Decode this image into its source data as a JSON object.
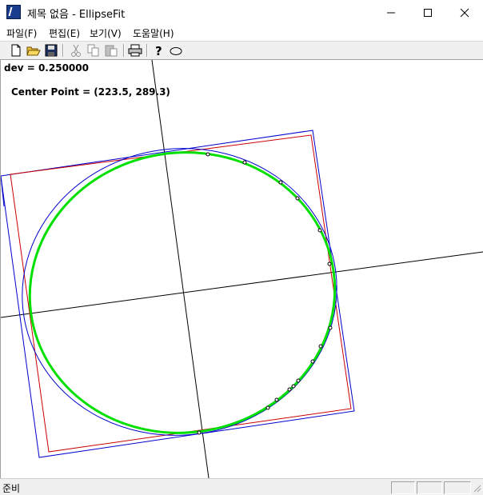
{
  "window": {
    "title": "제목 없음 - EllipseFit",
    "minimize_icon": "minimize-icon",
    "maximize_icon": "maximize-icon",
    "close_icon": "close-icon"
  },
  "menu": {
    "items": [
      {
        "label": "파일(F)"
      },
      {
        "label": "편집(E)"
      },
      {
        "label": "보기(V)"
      },
      {
        "label": "도움말(H)"
      }
    ]
  },
  "toolbar": {
    "buttons": [
      {
        "icon": "new-document-icon"
      },
      {
        "icon": "open-folder-icon"
      },
      {
        "icon": "save-icon"
      },
      {
        "icon": "cut-icon"
      },
      {
        "icon": "copy-icon"
      },
      {
        "icon": "paste-icon"
      },
      {
        "icon": "print-icon"
      },
      {
        "icon": "help-icon"
      },
      {
        "icon": "ellipse-icon"
      }
    ]
  },
  "canvas": {
    "dev_text": "dev = 0.250000",
    "center_text": "Center Point = (223.5, 289.3)",
    "colors": {
      "fitted_ellipse": "#00e000",
      "blue_ellipse": "#0000cc",
      "red_box": "#cc0000",
      "blue_box": "#0000cc",
      "axes": "#000000",
      "points": "#000000"
    }
  },
  "status": {
    "text": "준비"
  }
}
